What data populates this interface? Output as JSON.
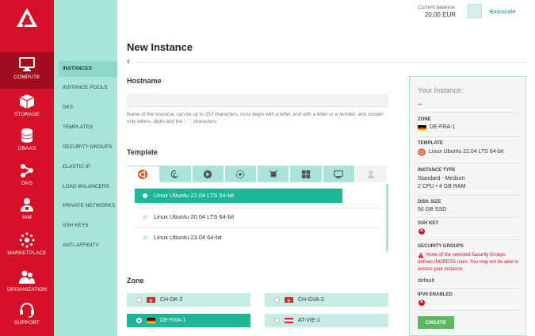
{
  "header": {
    "balance_label": "Current balance:",
    "balance_value": "20.00 EUR",
    "account_name": "Exoscale"
  },
  "rail": {
    "items": [
      {
        "label": "COMPUTE",
        "icon": "monitor-icon",
        "active": true
      },
      {
        "label": "STORAGE",
        "icon": "cube-icon"
      },
      {
        "label": "DBAAS",
        "icon": "database-icon"
      },
      {
        "label": "DNS",
        "icon": "share-nodes-icon"
      },
      {
        "label": "IAM",
        "icon": "users-icon"
      },
      {
        "label": "MARKETPLACE",
        "icon": "marketplace-icon"
      },
      {
        "label": "ORGANIZATION",
        "icon": "organization-icon"
      },
      {
        "label": "SUPPORT",
        "icon": "headset-icon"
      }
    ]
  },
  "subnav": {
    "items": [
      {
        "label": "INSTANCES",
        "active": true
      },
      {
        "label": "INSTANCE POOLS"
      },
      {
        "label": "SKS"
      },
      {
        "label": "TEMPLATES"
      },
      {
        "label": "SECURITY GROUPS"
      },
      {
        "label": "ELASTIC IP"
      },
      {
        "label": "LOAD BALANCERS"
      },
      {
        "label": "PRIVATE NETWORKS"
      },
      {
        "label": "SSH KEYS"
      },
      {
        "label": "ANTI-AFFINITY"
      }
    ]
  },
  "main": {
    "title": "New Instance",
    "back_glyph": "‹",
    "hostname": {
      "label": "Hostname",
      "value": "",
      "help": "Name of the resource, can be up to 253 characters, must begin with a letter, end with a letter or a number, and contain only letters, digits and the '-' '.' characters."
    },
    "template": {
      "label": "Template",
      "tabs": [
        "ubuntu-icon",
        "debian-icon",
        "centos-icon",
        "fedora-icon",
        "freebsd-icon",
        "windows-icon",
        "appliance-icon",
        "user-icon"
      ],
      "options": [
        {
          "label": "Linux Ubuntu 22.04 LTS 64-bit",
          "selected": true
        },
        {
          "label": "Linux Ubuntu 20.04 LTS 64-bit"
        },
        {
          "label": "Linux Ubuntu 23.04 64-bit"
        }
      ]
    },
    "zone": {
      "label": "Zone",
      "options": [
        {
          "label": "CH-DK-2",
          "flag": "ch"
        },
        {
          "label": "CH-GVA-2",
          "flag": "ch"
        },
        {
          "label": "DE-FRA-1",
          "flag": "de",
          "selected": true
        },
        {
          "label": "AT-VIE-1",
          "flag": "at"
        }
      ]
    }
  },
  "summary": {
    "heading": "Your Instance:",
    "name": "–",
    "zone_label": "ZONE",
    "zone_value": "DE-FRA-1",
    "template_label": "TEMPLATE",
    "template_value": "Linux Ubuntu 22.04 LTS 64-bit",
    "type_label": "INSTANCE TYPE",
    "type_value": "Standard - Medium",
    "type_spec": "2 CPU • 4 GB RAM",
    "disk_label": "DISK SIZE",
    "disk_value": "50 GB SSD",
    "ssh_label": "SSH KEY",
    "sg_label": "SECURITY GROUPS",
    "sg_warning": "None of the selected Security Groups defines INGRESS rules. You may not be able to access your instance.",
    "sg_value": "default",
    "ipv6_label": "IPV6 ENABLED",
    "create_label": "CREATE"
  },
  "colors": {
    "brand_red": "#d7102a",
    "mint": "#a8e4d9",
    "selected_teal": "#1ab897",
    "create_green": "#5cb85c"
  }
}
